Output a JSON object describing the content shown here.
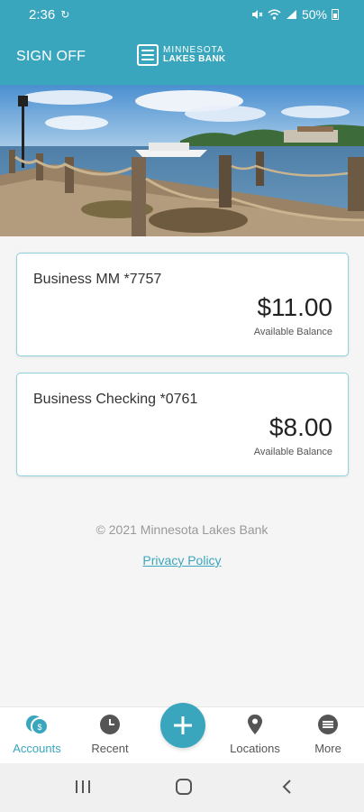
{
  "status_bar": {
    "time": "2:36",
    "battery": "50%",
    "icons": [
      "sync-icon",
      "mute-icon",
      "wifi-icon",
      "signal-icon",
      "battery-icon"
    ]
  },
  "header": {
    "sign_off_label": "SIGN OFF",
    "logo_line1": "MINNESOTA",
    "logo_line2": "LAKES BANK",
    "color": "#3aa6bd"
  },
  "accounts": [
    {
      "name": "Business MM *7757",
      "amount": "$11.00",
      "balance_label": "Available Balance"
    },
    {
      "name": "Business Checking *0761",
      "amount": "$8.00",
      "balance_label": "Available Balance"
    }
  ],
  "footer": {
    "copyright": "© 2021 Minnesota Lakes Bank",
    "privacy_label": "Privacy Policy"
  },
  "bottom_nav": {
    "items": [
      {
        "label": "Accounts",
        "icon": "accounts-icon",
        "active": true
      },
      {
        "label": "Recent",
        "icon": "clock-icon",
        "active": false
      },
      {
        "label": "Locations",
        "icon": "location-pin-icon",
        "active": false
      },
      {
        "label": "More",
        "icon": "more-icon",
        "active": false
      }
    ],
    "fab_icon": "plus-icon"
  },
  "system_nav": {
    "icons": [
      "recents-icon",
      "home-icon",
      "back-icon"
    ]
  },
  "colors": {
    "accent": "#3aa6bd",
    "card_border": "#8fd0dd",
    "background": "#f5f5f5"
  }
}
